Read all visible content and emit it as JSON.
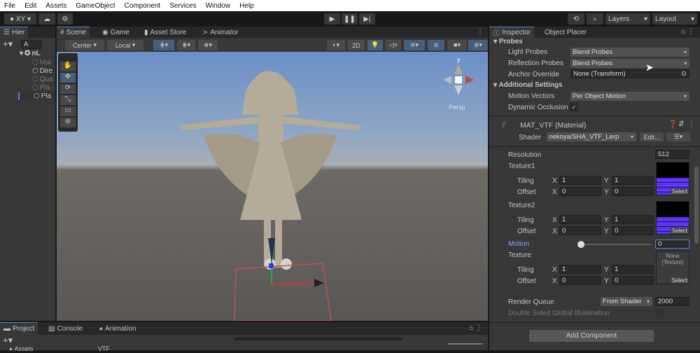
{
  "menu": [
    "File",
    "Edit",
    "Assets",
    "GameObject",
    "Component",
    "Services",
    "Window",
    "Help"
  ],
  "toolbar": {
    "account": "XY",
    "layers": "Layers",
    "layout": "Layout"
  },
  "hierarchy": {
    "tab": "Hier",
    "search_placeholder": "A",
    "root": "nL",
    "items": [
      "Mai",
      "Dire",
      "Qua",
      "Pla",
      "Pla"
    ]
  },
  "scene": {
    "tabs": [
      "Scene",
      "Game",
      "Asset Store",
      "Animator"
    ],
    "pivot": "Center",
    "space": "Local",
    "mode_2d": "2D",
    "gizmo_axis": "y",
    "persp": "Persp"
  },
  "bottom": {
    "tabs": [
      "Project",
      "Console",
      "Animation"
    ],
    "assets": "Assets",
    "path": "VTF"
  },
  "inspector": {
    "tabs": [
      "Inspector",
      "Object Placer"
    ],
    "probes": "Probes",
    "light_probes_label": "Light Probes",
    "light_probes": "Blend Probes",
    "reflection_label": "Reflection Probes",
    "reflection": "Blend Probes",
    "anchor_label": "Anchor Override",
    "anchor": "None (Transform)",
    "additional": "Additional Settings",
    "motion_vectors_label": "Motion Vectors",
    "motion_vectors": "Per Object Motion",
    "dynamic_label": "Dynamic Occlusion",
    "dynamic_checked": true,
    "material": "MAT_VTF (Material)",
    "shader_label": "Shader",
    "shader": "nekoya/SHA_VTF_Lerp",
    "edit": "Edit...",
    "resolution_label": "Resolution",
    "resolution": "512",
    "texture1": "Texture1",
    "texture2": "Texture2",
    "texture3": "Texture",
    "tiling": "Tiling",
    "offset": "Offset",
    "x": "X",
    "y": "Y",
    "t1": {
      "tx": "1",
      "ty": "1",
      "ox": "0",
      "oy": "0"
    },
    "t2": {
      "tx": "1",
      "ty": "1",
      "ox": "0",
      "oy": "0"
    },
    "t3": {
      "tx": "1",
      "ty": "1",
      "ox": "0",
      "oy": "0"
    },
    "select": "Select",
    "none_texture": "None\n(Texture)",
    "motion_label": "Motion",
    "motion": "0",
    "motion_fraction": 0,
    "render_queue_label": "Render Queue",
    "render_queue_mode": "From Shader",
    "render_queue": "2000",
    "double_sided": "Double Sided Global Illumination",
    "add_component": "Add Component"
  }
}
